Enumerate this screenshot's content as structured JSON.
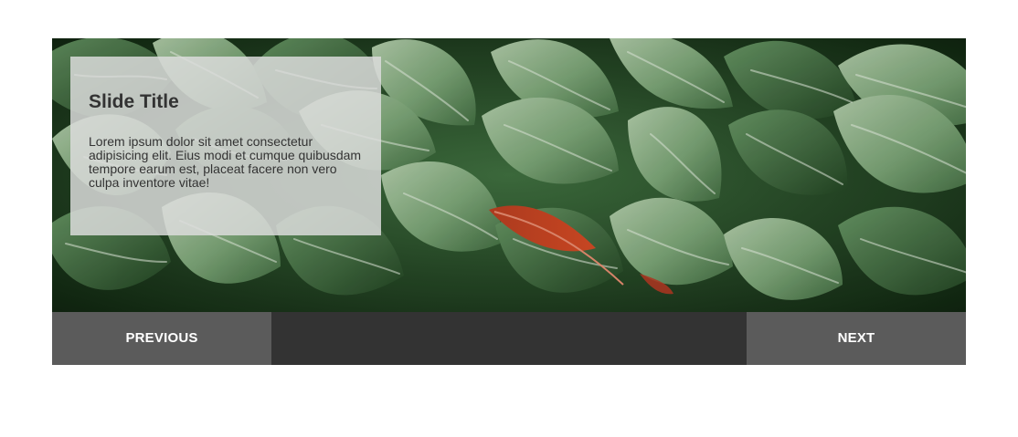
{
  "slide": {
    "title": "Slide Title",
    "text": "Lorem ipsum dolor sit amet consectetur adipisicing elit. Eius modi et cumque quibusdam tempore earum est, placeat facere non vero culpa inventore vitae!",
    "image_description": "green foliage with red leaf"
  },
  "controls": {
    "previous_label": "PREVIOUS",
    "next_label": "NEXT"
  },
  "colors": {
    "control_bar": "#333333",
    "button": "#5b5b5b",
    "caption_background": "#dcdcdc"
  }
}
